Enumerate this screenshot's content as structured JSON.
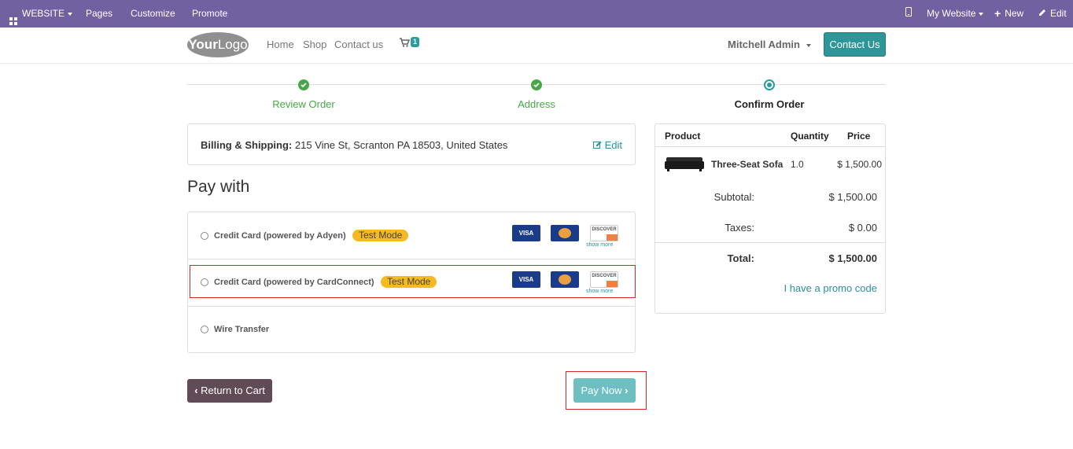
{
  "adminbar": {
    "website_label": "WEBSITE",
    "pages": "Pages",
    "customize": "Customize",
    "promote": "Promote",
    "my_website": "My Website",
    "new": "New",
    "edit": "Edit"
  },
  "header": {
    "logo_text_bold": "Your",
    "logo_text": "Logo",
    "nav": [
      "Home",
      "Shop",
      "Contact us"
    ],
    "cart_count": "1",
    "user": "Mitchell Admin",
    "contact_button": "Contact Us"
  },
  "steps": [
    {
      "label": "Review Order",
      "state": "done"
    },
    {
      "label": "Address",
      "state": "done"
    },
    {
      "label": "Confirm Order",
      "state": "current"
    }
  ],
  "billing": {
    "label": "Billing & Shipping:",
    "address": "215 Vine St, Scranton PA 18503, United States",
    "edit": "Edit"
  },
  "pay_with_title": "Pay with",
  "payment_methods": [
    {
      "name": "Credit Card (powered by Adyen)",
      "badge": "Test Mode",
      "cards": [
        "VISA",
        "MasterCard",
        "DISCOVER"
      ],
      "show_more": "show more"
    },
    {
      "name": "Credit Card (powered by CardConnect)",
      "badge": "Test Mode",
      "cards": [
        "VISA",
        "MasterCard",
        "DISCOVER"
      ],
      "show_more": "show more"
    },
    {
      "name": "Wire Transfer"
    }
  ],
  "buttons": {
    "return_to_cart": "Return to Cart",
    "pay_now": "Pay Now"
  },
  "summary": {
    "headers": {
      "product": "Product",
      "quantity": "Quantity",
      "price": "Price"
    },
    "item": {
      "name": "Three-Seat Sofa",
      "quantity": "1.0",
      "price": "$ 1,500.00"
    },
    "subtotal_label": "Subtotal:",
    "subtotal": "$ 1,500.00",
    "taxes_label": "Taxes:",
    "taxes": "$ 0.00",
    "total_label": "Total:",
    "total": "$ 1,500.00",
    "promo": "I have a promo code"
  },
  "colors": {
    "admin_bar": "#7161a1",
    "accent": "#2e9698",
    "done_step": "#47a747",
    "test_badge": "#f5b921",
    "highlight": "#d92626"
  }
}
